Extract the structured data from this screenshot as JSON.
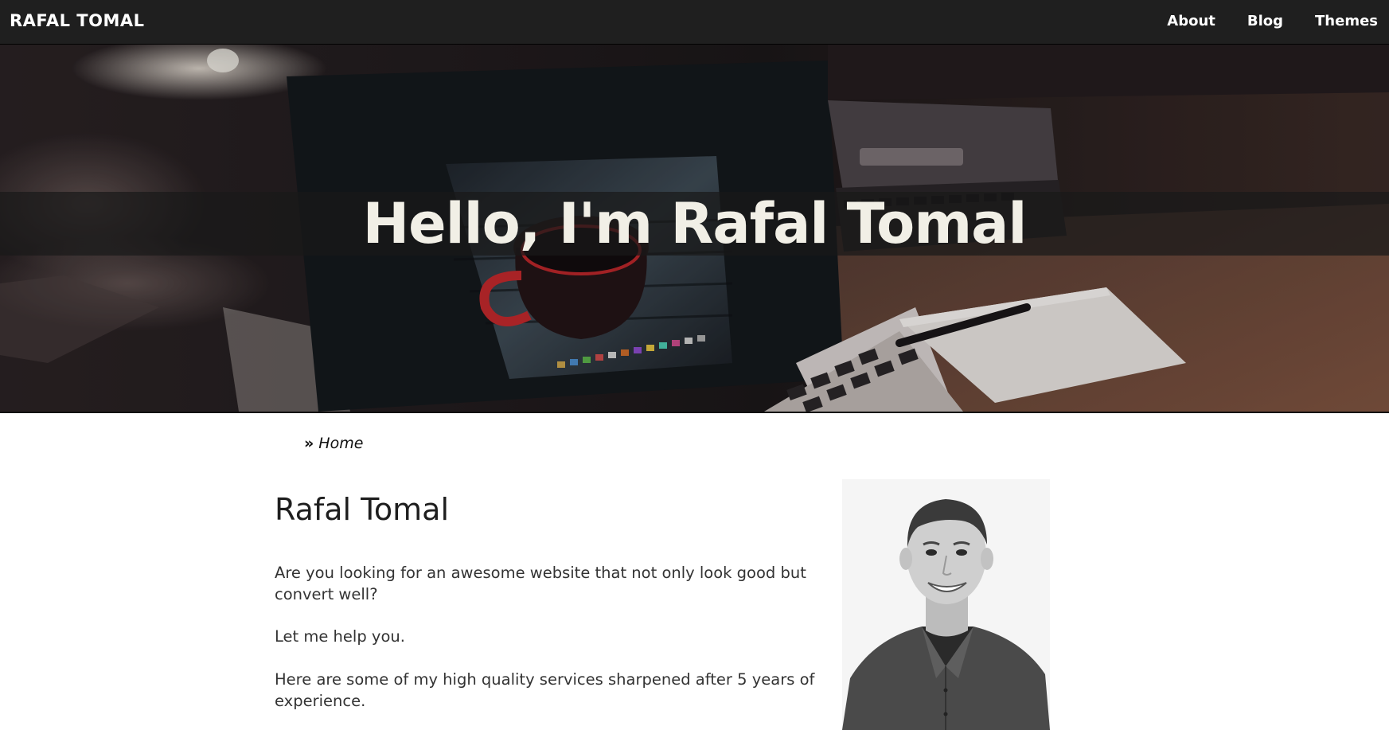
{
  "navbar": {
    "brand": "RAFAL TOMAL",
    "links": [
      "About",
      "Blog",
      "Themes"
    ]
  },
  "hero": {
    "title": "Hello, I'm Rafal Tomal"
  },
  "breadcrumb": {
    "separator": "»",
    "current": "Home"
  },
  "content": {
    "title": "Rafal Tomal",
    "paragraphs": [
      "Are you looking for an awesome website that not only look good but convert well?",
      "Let me help you.",
      "Here are some of my high quality services sharpened after 5 years of experience."
    ]
  },
  "colors": {
    "navbar_bg": "#1f1f1f",
    "hero_title": "#f1efe6",
    "text": "#333333"
  }
}
